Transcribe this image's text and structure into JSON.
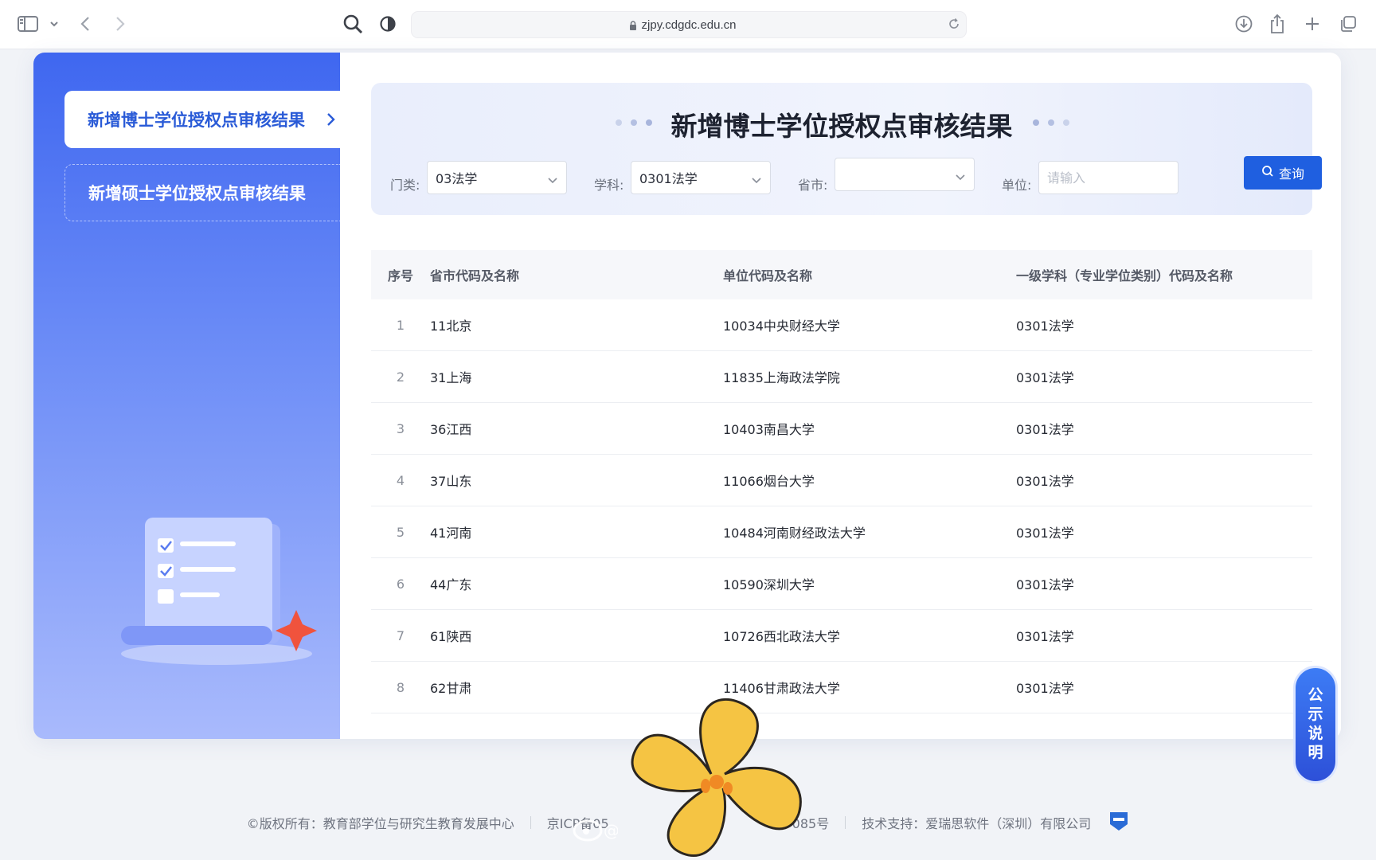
{
  "browser": {
    "url": "zjpy.cdgdc.edu.cn"
  },
  "sidebar": {
    "items": [
      {
        "label": "新增博士学位授权点审核结果"
      },
      {
        "label": "新增硕士学位授权点审核结果"
      }
    ]
  },
  "filters": {
    "title": "新增博士学位授权点审核结果",
    "category_label": "门类:",
    "category_value": "03法学",
    "subject_label": "学科:",
    "subject_value": "0301法学",
    "province_label": "省市:",
    "province_value": "",
    "unit_label": "单位:",
    "unit_placeholder": "请输入",
    "query_label": "查询"
  },
  "table": {
    "headers": [
      "序号",
      "省市代码及名称",
      "单位代码及名称",
      "一级学科（专业学位类别）代码及名称"
    ],
    "rows": [
      {
        "idx": "1",
        "province": "11北京",
        "unit": "10034中央财经大学",
        "subject": "0301法学"
      },
      {
        "idx": "2",
        "province": "31上海",
        "unit": "11835上海政法学院",
        "subject": "0301法学"
      },
      {
        "idx": "3",
        "province": "36江西",
        "unit": "10403南昌大学",
        "subject": "0301法学"
      },
      {
        "idx": "4",
        "province": "37山东",
        "unit": "11066烟台大学",
        "subject": "0301法学"
      },
      {
        "idx": "5",
        "province": "41河南",
        "unit": "10484河南财经政法大学",
        "subject": "0301法学"
      },
      {
        "idx": "6",
        "province": "44广东",
        "unit": "10590深圳大学",
        "subject": "0301法学"
      },
      {
        "idx": "7",
        "province": "61陕西",
        "unit": "10726西北政法大学",
        "subject": "0301法学"
      },
      {
        "idx": "8",
        "province": "62甘肃",
        "unit": "11406甘肃政法大学",
        "subject": "0301法学"
      }
    ]
  },
  "notice_tab": {
    "chars": [
      "公",
      "示",
      "说",
      "明"
    ]
  },
  "footer": {
    "copyright": "©版权所有：教育部学位与研究生教育发展中心",
    "icp": "京ICP备05",
    "icp_tail": "085号",
    "support": "技术支持：爱瑞思软件（深圳）有限公司"
  },
  "colors": {
    "accent": "#1f5fe0",
    "sidebar_top": "#3f67f0",
    "sidebar_bottom": "#a9bafc"
  }
}
